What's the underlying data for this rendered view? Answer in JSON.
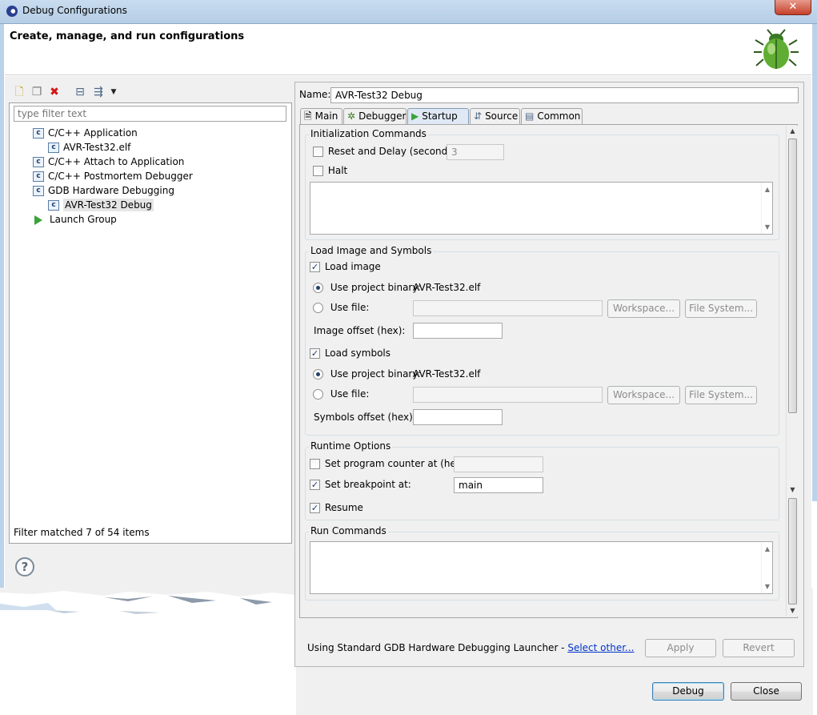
{
  "window": {
    "title": "Debug Configurations",
    "close_glyph": "✕"
  },
  "header": {
    "title": "Create, manage, and run configurations",
    "icon": "bug-icon"
  },
  "left": {
    "filter_placeholder": "type filter text",
    "toolbar_icons": [
      "new-config-icon",
      "duplicate-icon",
      "delete-icon",
      "collapse-all-icon",
      "filter-icon",
      "dropdown-icon"
    ],
    "tree": [
      {
        "label": "C/C++ Application",
        "icon": "c-config-icon",
        "level": 0
      },
      {
        "label": "AVR-Test32.elf",
        "icon": "c-config-icon",
        "level": 1
      },
      {
        "label": "C/C++ Attach to Application",
        "icon": "c-config-icon",
        "level": 0
      },
      {
        "label": "C/C++ Postmortem Debugger",
        "icon": "c-config-icon",
        "level": 0
      },
      {
        "label": "GDB Hardware Debugging",
        "icon": "c-config-icon",
        "level": 0
      },
      {
        "label": "AVR-Test32 Debug",
        "icon": "c-config-icon",
        "level": 1,
        "selected": true
      },
      {
        "label": "Launch Group",
        "icon": "launch-group-icon",
        "level": 0
      }
    ],
    "filter_status": "Filter matched 7 of 54 items"
  },
  "right": {
    "name_label": "Name:",
    "name_value": "AVR-Test32 Debug",
    "tabs": [
      {
        "label": "Main"
      },
      {
        "label": "Debugger"
      },
      {
        "label": "Startup",
        "active": true
      },
      {
        "label": "Source"
      },
      {
        "label": "Common"
      }
    ],
    "init": {
      "title": "Initialization Commands",
      "reset_label": "Reset and Delay (seconds):",
      "reset_value": "3",
      "halt_label": "Halt"
    },
    "load": {
      "title": "Load Image and Symbols",
      "load_image_label": "Load image",
      "use_project_binary_label": "Use project binary:",
      "image_binary": "AVR-Test32.elf",
      "use_file_label": "Use file:",
      "workspace_btn": "Workspace...",
      "filesystem_btn": "File System...",
      "image_offset_label": "Image offset (hex):",
      "load_symbols_label": "Load symbols",
      "symbols_binary": "AVR-Test32.elf",
      "symbols_offset_label": "Symbols offset (hex):"
    },
    "runtime": {
      "title": "Runtime Options",
      "pc_label": "Set program counter at (hex):",
      "bp_label": "Set breakpoint at:",
      "bp_value": "main",
      "resume_label": "Resume"
    },
    "run_cmds": {
      "title": "Run Commands"
    },
    "launcher": {
      "text": "Using Standard GDB Hardware Debugging Launcher - ",
      "link": "Select other..."
    },
    "apply_btn": "Apply",
    "revert_btn": "Revert"
  },
  "footer": {
    "debug_btn": "Debug",
    "close_btn": "Close",
    "help_glyph": "?"
  }
}
